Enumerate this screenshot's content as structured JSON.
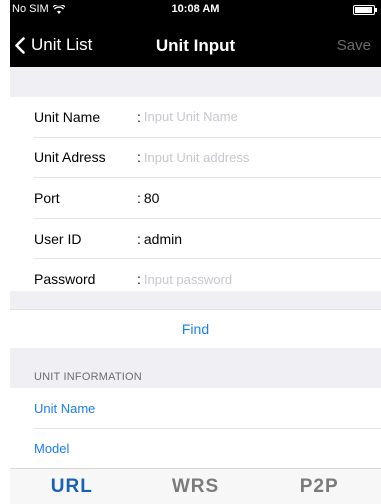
{
  "status_bar": {
    "carrier": "No SIM",
    "time": "10:08 AM",
    "battery_percent": 95
  },
  "nav": {
    "back_label": "Unit List",
    "title": "Unit Input",
    "save_label": "Save"
  },
  "form": {
    "fields": [
      {
        "label": "Unit Name",
        "value": "",
        "placeholder": "Input Unit Name"
      },
      {
        "label": "Unit Adress",
        "value": "",
        "placeholder": "Input Unit address"
      },
      {
        "label": "Port",
        "value": "80",
        "placeholder": ""
      },
      {
        "label": "User ID",
        "value": "admin",
        "placeholder": ""
      },
      {
        "label": "Password",
        "value": "",
        "placeholder": "Input password"
      }
    ],
    "separator": ":"
  },
  "find_label": "Find",
  "unit_information": {
    "header": "UNIT INFORMATION",
    "items": [
      {
        "label": "Unit Name"
      },
      {
        "label": "Model"
      }
    ]
  },
  "tabs": [
    {
      "label": "URL",
      "active": true
    },
    {
      "label": "WRS",
      "active": false
    },
    {
      "label": "P2P",
      "active": false
    }
  ],
  "colors": {
    "accent": "#1a7ef4",
    "active_tab": "#1a5fb8",
    "inactive_tab": "#7a7a7a",
    "nav_background": "#000000",
    "group_background": "#efeff4"
  }
}
